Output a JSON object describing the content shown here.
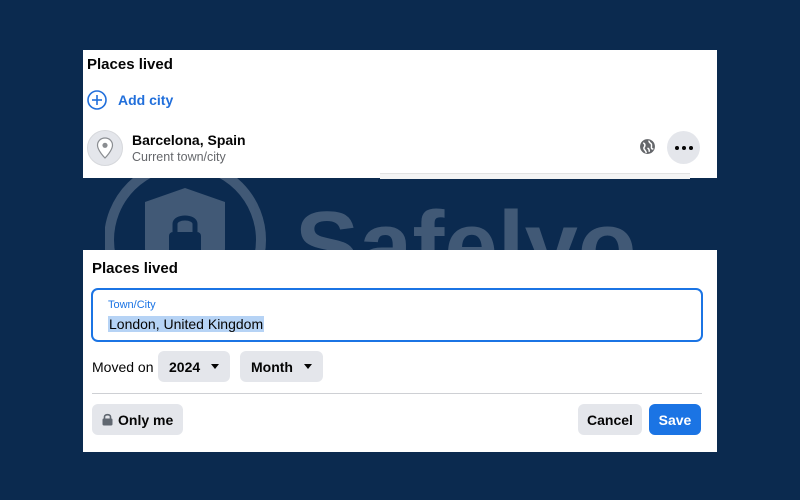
{
  "places_card": {
    "title": "Places lived",
    "add_city_label": "Add city",
    "place": {
      "name": "Barcelona, Spain",
      "subtitle": "Current town/city",
      "privacy_icon": "globe-icon",
      "more_icon": "more-options-icon"
    }
  },
  "watermark": {
    "text": "Safelyo",
    "icon": "shield-lock-icon"
  },
  "edit_card": {
    "title": "Places lived",
    "city_field": {
      "label": "Town/City",
      "value": "London, United Kingdom"
    },
    "moved_on_label": "Moved on",
    "year_select": "2024",
    "month_select": "Month",
    "privacy_label": "Only me",
    "cancel_label": "Cancel",
    "save_label": "Save"
  },
  "colors": {
    "background": "#0b2a4f",
    "accent": "#1b74e4",
    "link": "#216fdb",
    "button_gray": "#e4e6eb"
  }
}
